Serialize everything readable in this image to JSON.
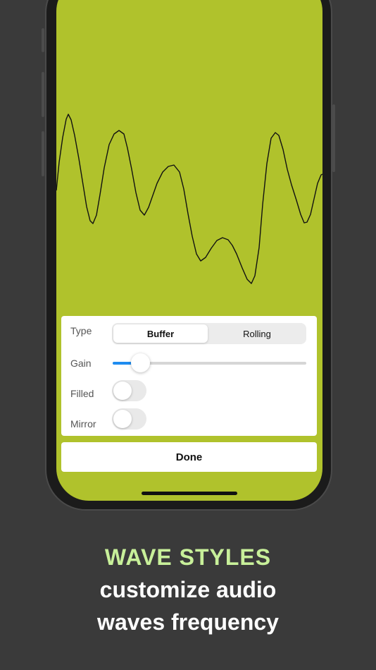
{
  "colors": {
    "background": "#3a3a3a",
    "screen": "#b0c22c",
    "accent_title": "#c8f09a",
    "slider_fill": "#1e8cf0",
    "wave_line": "#111111"
  },
  "wave": {
    "style": "Buffer",
    "mode": "line"
  },
  "settings": {
    "type_label": "Type",
    "type_options": [
      "Buffer",
      "Rolling"
    ],
    "type_selected": "Buffer",
    "gain_label": "Gain",
    "gain_value": 0.14,
    "filled_label": "Filled",
    "filled_on": false,
    "mirror_label": "Mirror",
    "mirror_on": false
  },
  "done_label": "Done",
  "promo": {
    "title": "WAVE STYLES",
    "line1": "customize audio",
    "line2": "waves frequency"
  }
}
